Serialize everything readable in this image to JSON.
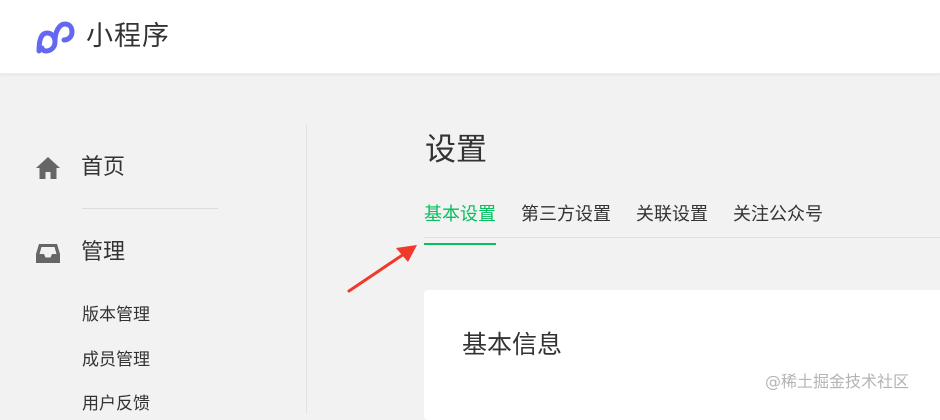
{
  "header": {
    "logo_icon": "mini-program-logo-icon",
    "title": "小程序",
    "brand_color": "#6467f0"
  },
  "sidebar": {
    "items": [
      {
        "icon": "home-icon",
        "label": "首页"
      },
      {
        "icon": "inbox-icon",
        "label": "管理"
      }
    ],
    "sub_items": [
      {
        "label": "版本管理"
      },
      {
        "label": "成员管理"
      },
      {
        "label": "用户反馈"
      }
    ]
  },
  "main": {
    "title": "设置",
    "tabs": [
      {
        "label": "基本设置",
        "active": true
      },
      {
        "label": "第三方设置",
        "active": false
      },
      {
        "label": "关联设置",
        "active": false
      },
      {
        "label": "关注公众号",
        "active": false
      }
    ],
    "accent_color": "#07c160",
    "card": {
      "title": "基本信息"
    }
  },
  "annotation": {
    "icon": "red-arrow-icon",
    "color": "#f0382b"
  },
  "watermark": {
    "text": "@稀土掘金技术社区"
  }
}
